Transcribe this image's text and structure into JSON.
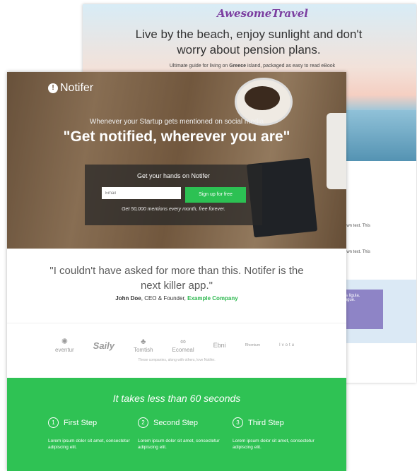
{
  "back_page": {
    "logo": "AwesomeTravel",
    "headline": "Live by the beach, enjoy sunlight and don't worry about pension plans.",
    "subheadline_prefix": "Ultimate guide for living on ",
    "subheadline_bold": "Greece",
    "subheadline_suffix": " island, packaged as easy to read eBook",
    "snippet_1": "own text. This",
    "snippet_2": "own text. This",
    "purple_text_1": "stas ligula.",
    "purple_text_2": "t augue."
  },
  "front_page": {
    "logo_text": "Notifer",
    "logo_icon": "exclamation-circle-icon",
    "hero_subtitle": "Whenever your Startup gets mentioned on social media",
    "hero_title": "\"Get notified, wherever you are\"",
    "signup": {
      "title": "Get your hands on Notifer",
      "email_placeholder": "Email",
      "button_label": "Sign up for free",
      "note": "Get 50,000 mentions every month, free forever."
    },
    "testimonial": {
      "quote": "\"I couldn't have asked for more than this. Notifer is the next killer app.\"",
      "author_name": "John Doe",
      "author_role": ", CEO & Founder, ",
      "author_company": "Example Company"
    },
    "company_logos": [
      "eventur",
      "Saily",
      "Tomtish",
      "Ecomeal",
      "Ebni",
      "Rhomium",
      "Ivotu"
    ],
    "logos_caption": "These companies, along with others, love Notifer.",
    "steps_section": {
      "title": "It takes less than 60 seconds",
      "steps": [
        {
          "number": "1",
          "title": "First Step",
          "text": "Lorem ipsum dolor sit amet, consectetur adipiscing elit."
        },
        {
          "number": "2",
          "title": "Second Step",
          "text": "Lorem ipsum dolor sit amet, consectetur adipiscing elit."
        },
        {
          "number": "3",
          "title": "Third Step",
          "text": "Lorem ipsum dolor sit amet, consectetur adipiscing elit."
        }
      ]
    },
    "colors": {
      "accent_green": "#2fc254",
      "link_green": "#2cb84e"
    }
  }
}
